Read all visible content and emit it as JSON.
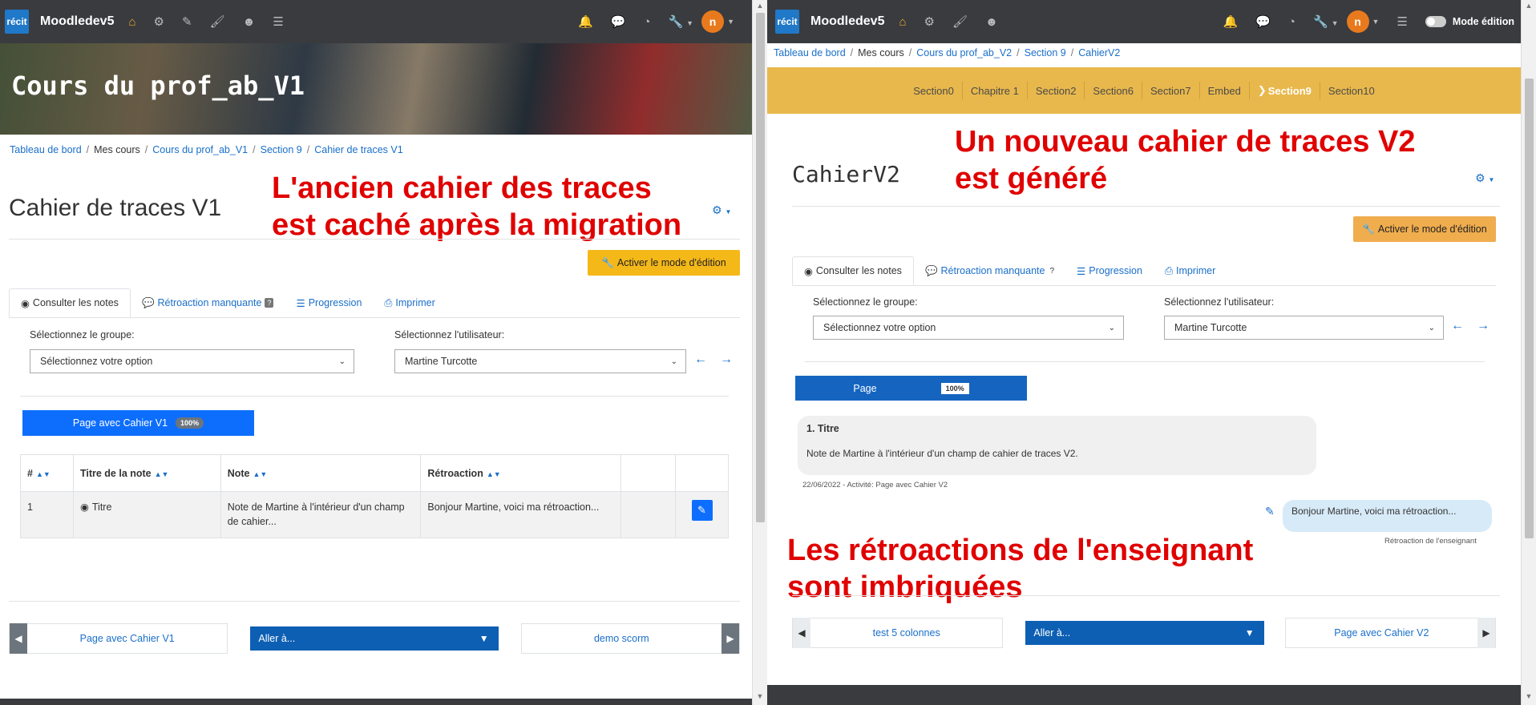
{
  "left": {
    "brand": "Moodledev5",
    "logo": "récit",
    "avatar_letter": "n",
    "course_banner_title": "Cours du prof_ab_V1",
    "breadcrumb": [
      "Tableau de bord",
      "Mes cours",
      "Cours du prof_ab_V1",
      "Section 9",
      "Cahier de traces V1"
    ],
    "page_title": "Cahier de traces V1",
    "annotation_line1": "L'ancien cahier des traces",
    "annotation_line2": "est caché après la migration",
    "edit_mode_button": "Activer le mode d'édition",
    "tabs": [
      "Consulter les notes",
      "Rétroaction manquante",
      "Progression",
      "Imprimer"
    ],
    "missing_badge": "?",
    "group_label": "Sélectionnez le groupe:",
    "group_value": "Sélectionnez votre option",
    "user_label": "Sélectionnez l'utilisateur:",
    "user_value": "Martine Turcotte",
    "page_button": "Page avec Cahier V1",
    "page_badge": "100%",
    "table_headers": [
      "#",
      "Titre de la note",
      "Note",
      "Rétroaction"
    ],
    "row": {
      "num": "1",
      "title": "Titre",
      "note": "Note de Martine à l'intérieur d'un champ de cahier...",
      "feedback": "Bonjour Martine, voici ma rétroaction..."
    },
    "prev_activity": "Page avec Cahier V1",
    "goto": "Aller à...",
    "next_activity": "demo scorm"
  },
  "right": {
    "brand": "Moodledev5",
    "logo": "récit",
    "avatar_letter": "n",
    "edit_mode_label": "Mode édition",
    "breadcrumb": [
      "Tableau de bord",
      "Mes cours",
      "Cours du prof_ab_V2",
      "Section 9",
      "CahierV2"
    ],
    "sections": [
      "Section0",
      "Chapitre 1",
      "Section2",
      "Section6",
      "Section7",
      "Embed",
      "Section9",
      "Section10"
    ],
    "current_section": "Section9",
    "page_title": "CahierV2",
    "annotation_top_line1": "Un nouveau cahier de traces V2",
    "annotation_top_line2": "est généré",
    "edit_mode_button": "Activer le mode d'édition",
    "tabs": [
      "Consulter les notes",
      "Rétroaction manquante",
      "Progression",
      "Imprimer"
    ],
    "missing_badge": "?",
    "group_label": "Sélectionnez le groupe:",
    "group_value": "Sélectionnez votre option",
    "user_label": "Sélectionnez l'utilisateur:",
    "user_value": "Martine Turcotte",
    "page_button": "Page",
    "page_badge": "100%",
    "note_title": "1. Titre",
    "note_text": "Note de Martine à l'intérieur d'un champ de cahier de traces V2.",
    "note_meta": "22/06/2022 - Activité: Page avec Cahier V2",
    "feedback_text": "Bonjour Martine, voici ma rétroaction...",
    "feedback_label": "Rétroaction de l'enseignant",
    "annotation_bottom_line1": "Les rétroactions de l'enseignant",
    "annotation_bottom_line2": "sont imbriquées",
    "prev_activity": "test 5 colonnes",
    "goto": "Aller à...",
    "next_activity": "Page avec Cahier V2"
  },
  "colors": {
    "navbar": "#393b3f",
    "accent_yellow": "#f5b819",
    "primary_blue": "#0d6efd",
    "annotation_red": "#e00000",
    "section_bar": "#e9b84c"
  }
}
